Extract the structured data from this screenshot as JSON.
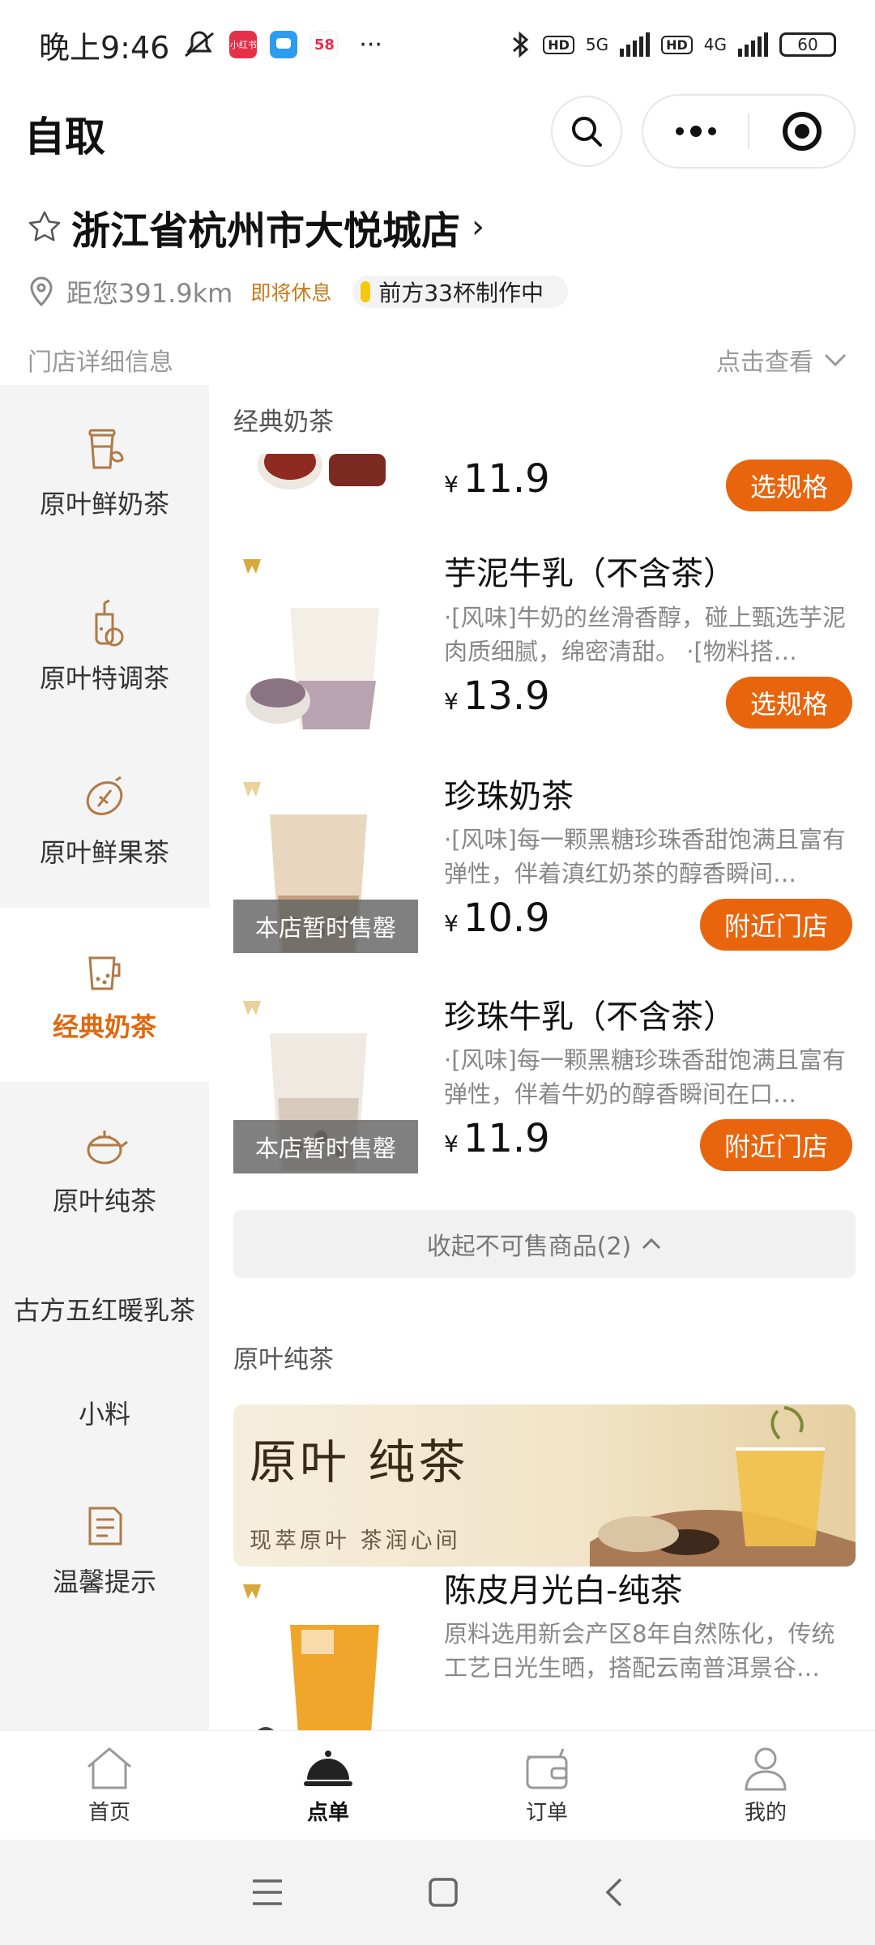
{
  "status_bar": {
    "time": "晚上9:46",
    "app_chips": [
      "小红书",
      "",
      "58"
    ],
    "more": "···",
    "network1": "5G",
    "network2": "4G",
    "hd": "HD",
    "battery": "60"
  },
  "header": {
    "title": "自取"
  },
  "store": {
    "name": "浙江省杭州市大悦城店",
    "distance": "距您391.9km",
    "status": "即将休息",
    "queue": "前方33杯制作中",
    "details_label": "门店详细信息",
    "view_label": "点击查看"
  },
  "sidebar": {
    "categories": [
      {
        "label": "原叶鲜奶茶",
        "icon": "milk-tea-cup-icon"
      },
      {
        "label": "原叶特调茶",
        "icon": "special-tea-icon"
      },
      {
        "label": "原叶鲜果茶",
        "icon": "lemon-icon"
      },
      {
        "label": "经典奶茶",
        "icon": "bubble-cup-icon"
      },
      {
        "label": "原叶纯茶",
        "icon": "teapot-icon"
      },
      {
        "label": "古方五红暖乳茶"
      },
      {
        "label": "小料"
      },
      {
        "label": "温馨提示",
        "icon": "notepad-icon"
      }
    ],
    "active": "经典奶茶"
  },
  "menu": {
    "section_classic": "经典奶茶",
    "items": [
      {
        "name": "",
        "desc": "",
        "price": "11.9",
        "button": "选规格"
      },
      {
        "name": "芋泥牛乳（不含茶）",
        "desc": "·[风味]牛奶的丝滑香醇，碰上甄选芋泥肉质细腻，绵密清甜。 ·[物料搭…",
        "price": "13.9",
        "button": "选规格"
      },
      {
        "name": "珍珠奶茶",
        "desc": "·[风味]每一颗黑糖珍珠香甜饱满且富有弹性，伴着滇红奶茶的醇香瞬间…",
        "price": "10.9",
        "button": "附近门店",
        "soldout": "本店暂时售罄"
      },
      {
        "name": "珍珠牛乳（不含茶）",
        "desc": "·[风味]每一颗黑糖珍珠香甜饱满且富有弹性，伴着牛奶的醇香瞬间在口…",
        "price": "11.9",
        "button": "附近门店",
        "soldout": "本店暂时售罄"
      }
    ],
    "currency": "¥",
    "collapse_label": "收起不可售商品(2)",
    "section_pure": "原叶纯茶",
    "banner_title": "原叶 纯茶",
    "banner_sub": "现萃原叶  茶润心间",
    "item_pure": {
      "name": "陈皮月光白-纯茶",
      "desc": "原料选用新会产区8年自然陈化，传统工艺日光生晒，搭配云南普洱景谷…"
    }
  },
  "bottom_nav": [
    {
      "label": "首页",
      "icon": "home-icon"
    },
    {
      "label": "点单",
      "icon": "cloche-icon"
    },
    {
      "label": "订单",
      "icon": "wallet-icon"
    },
    {
      "label": "我的",
      "icon": "user-icon"
    }
  ],
  "colors": {
    "accent": "#e8650e",
    "status": "#c97a1b",
    "queue_dot": "#f2c90f"
  }
}
